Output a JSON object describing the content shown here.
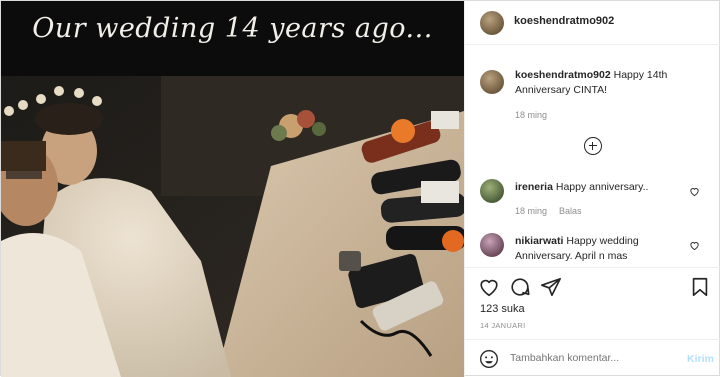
{
  "photo": {
    "caption": "Our wedding 14 years ago..."
  },
  "post": {
    "username": "koeshendratmo902",
    "caption_username": "koeshendratmo902",
    "caption_text": " Happy 14th Anniversary CINTA!",
    "caption_time": "18 ming"
  },
  "comments": [
    {
      "username": "ireneria",
      "text": " Happy anniversary..",
      "time": "18 ming",
      "reply": "Balas"
    },
    {
      "username": "nikiarwati",
      "text": " Happy wedding Anniversary. April n mas",
      "time": "",
      "reply": ""
    }
  ],
  "actions": {
    "likes": "123 suka",
    "date": "14 JANUARI"
  },
  "add_comment": {
    "placeholder": "Tambahkan komentar...",
    "post_label": "Kirim"
  },
  "colors": {
    "link_disabled": "#b2dffc",
    "secondary_text": "#8e8e8e",
    "border": "#efefef"
  },
  "icons": [
    "heart-icon",
    "comment-icon",
    "share-icon",
    "bookmark-icon",
    "emoji-icon",
    "load-more-icon"
  ]
}
